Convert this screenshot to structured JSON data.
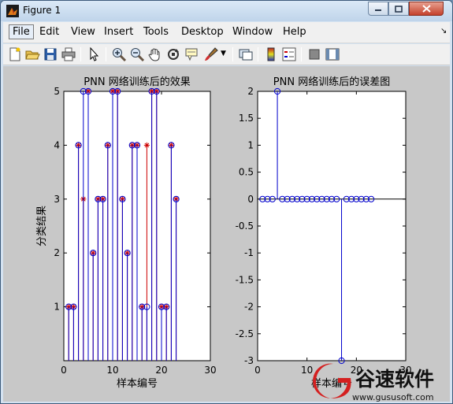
{
  "window": {
    "title": "Figure 1"
  },
  "menu": {
    "items": [
      "File",
      "Edit",
      "View",
      "Insert",
      "Tools",
      "Desktop",
      "Window",
      "Help"
    ]
  },
  "toolbar": {
    "buttons": [
      "new-figure-icon",
      "open-file-icon",
      "save-icon",
      "print-icon",
      "pointer-icon",
      "zoom-in-icon",
      "zoom-out-icon",
      "pan-icon",
      "rotate-3d-icon",
      "data-cursor-icon",
      "brush-icon",
      "link-plot-icon",
      "colorbar-icon",
      "legend-icon",
      "hide-plot-tools-icon",
      "show-plot-tools-icon"
    ]
  },
  "colors": {
    "stem_red": "#cc0000",
    "stem_blue": "#0000cc",
    "figure_bg": "#c8c8c8"
  },
  "chart_data": [
    {
      "type": "stem",
      "title": "PNN 网络训练后的效果",
      "xlabel": "样本编号",
      "ylabel": "分类结果",
      "xlim": [
        0,
        30
      ],
      "ylim": [
        0,
        5
      ],
      "xticks": [
        0,
        10,
        20,
        30
      ],
      "yticks": [
        1,
        2,
        3,
        4,
        5
      ],
      "grid": false,
      "series": [
        {
          "marker": "*",
          "color": "red",
          "x": [
            1,
            2,
            3,
            4,
            5,
            6,
            7,
            8,
            9,
            10,
            11,
            12,
            13,
            14,
            15,
            16,
            17,
            18,
            19,
            20,
            21,
            22,
            23
          ],
          "values": [
            1,
            1,
            4,
            3,
            5,
            2,
            3,
            3,
            4,
            5,
            5,
            3,
            2,
            4,
            4,
            1,
            4,
            5,
            5,
            1,
            1,
            4,
            3
          ]
        },
        {
          "marker": "o",
          "color": "blue",
          "x": [
            1,
            2,
            3,
            4,
            5,
            6,
            7,
            8,
            9,
            10,
            11,
            12,
            13,
            14,
            15,
            16,
            17,
            18,
            19,
            20,
            21,
            22,
            23
          ],
          "values": [
            1,
            1,
            4,
            5,
            5,
            2,
            3,
            3,
            4,
            5,
            5,
            3,
            2,
            4,
            4,
            1,
            1,
            5,
            5,
            1,
            1,
            4,
            3
          ]
        }
      ]
    },
    {
      "type": "stem",
      "title": "PNN 网络训练后的误差图",
      "xlabel": "样本编号",
      "ylabel": "",
      "xlim": [
        0,
        30
      ],
      "ylim": [
        -3,
        2
      ],
      "xticks": [
        0,
        10,
        20,
        30
      ],
      "yticks": [
        -3,
        -2.5,
        -2,
        -1.5,
        -1,
        -0.5,
        0,
        0.5,
        1,
        1.5,
        2
      ],
      "grid": false,
      "series": [
        {
          "marker": "o",
          "color": "blue",
          "x": [
            1,
            2,
            3,
            4,
            5,
            6,
            7,
            8,
            9,
            10,
            11,
            12,
            13,
            14,
            15,
            16,
            17,
            18,
            19,
            20,
            21,
            22,
            23
          ],
          "values": [
            0,
            0,
            0,
            2,
            0,
            0,
            0,
            0,
            0,
            0,
            0,
            0,
            0,
            0,
            0,
            0,
            -3,
            0,
            0,
            0,
            0,
            0,
            0
          ]
        }
      ]
    }
  ],
  "watermark": {
    "brand": "谷速软件",
    "url": "www.gususoft.com"
  }
}
